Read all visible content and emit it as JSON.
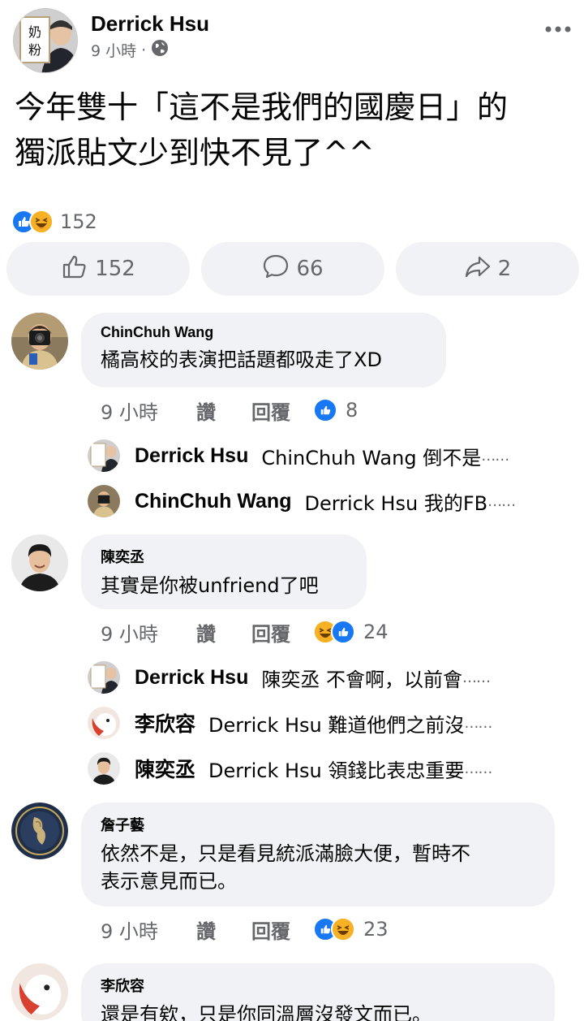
{
  "post": {
    "author": "Derrick Hsu",
    "time": "9 小時",
    "separator": "·",
    "text_line1": "今年雙十「這不是我們的國慶日」的",
    "text_line2": "獨派貼文少到快不見了^^",
    "reaction_count": "152",
    "avatar_sign_text": "奶粉"
  },
  "actions": {
    "like_count": "152",
    "comment_count": "66",
    "share_count": "2"
  },
  "comment_actions": {
    "like_label": "讚",
    "reply_label": "回覆"
  },
  "comments": [
    {
      "name": "ChinChuh Wang",
      "text": "橘高校的表演把話題都吸走了XD",
      "time": "9 小時",
      "reaction_count": "8",
      "replies": [
        {
          "name": "Derrick Hsu",
          "text": "ChinChuh Wang 倒不是",
          "ellipsis": "……"
        },
        {
          "name": "ChinChuh Wang",
          "text": "Derrick Hsu 我的FB",
          "ellipsis": "……"
        }
      ]
    },
    {
      "name": "陳奕丞",
      "text": "其實是你被unfriend了吧",
      "time": "9 小時",
      "reaction_count": "24",
      "replies": [
        {
          "name": "Derrick Hsu",
          "text": "陳奕丞 不會啊，以前會",
          "ellipsis": "……"
        },
        {
          "name": "李欣容",
          "text": "Derrick Hsu 難道他們之前沒",
          "ellipsis": "……"
        },
        {
          "name": "陳奕丞",
          "text": "Derrick Hsu 領錢比表忠重要",
          "ellipsis": "……"
        }
      ]
    },
    {
      "name": "詹子藝",
      "text_line1": "依然不是，只是看見統派滿臉大便，暫時不",
      "text_line2": "表示意見而已。",
      "time": "9 小時",
      "reaction_count": "23"
    },
    {
      "name": "李欣容",
      "text": "還是有欸，只是你同溫層沒發文而已。"
    }
  ],
  "colors": {
    "like_blue": "#1877f2",
    "haha_yellow": "#f7b125",
    "bubble_bg": "#f0f2f5",
    "secondary_text": "#65676b"
  }
}
